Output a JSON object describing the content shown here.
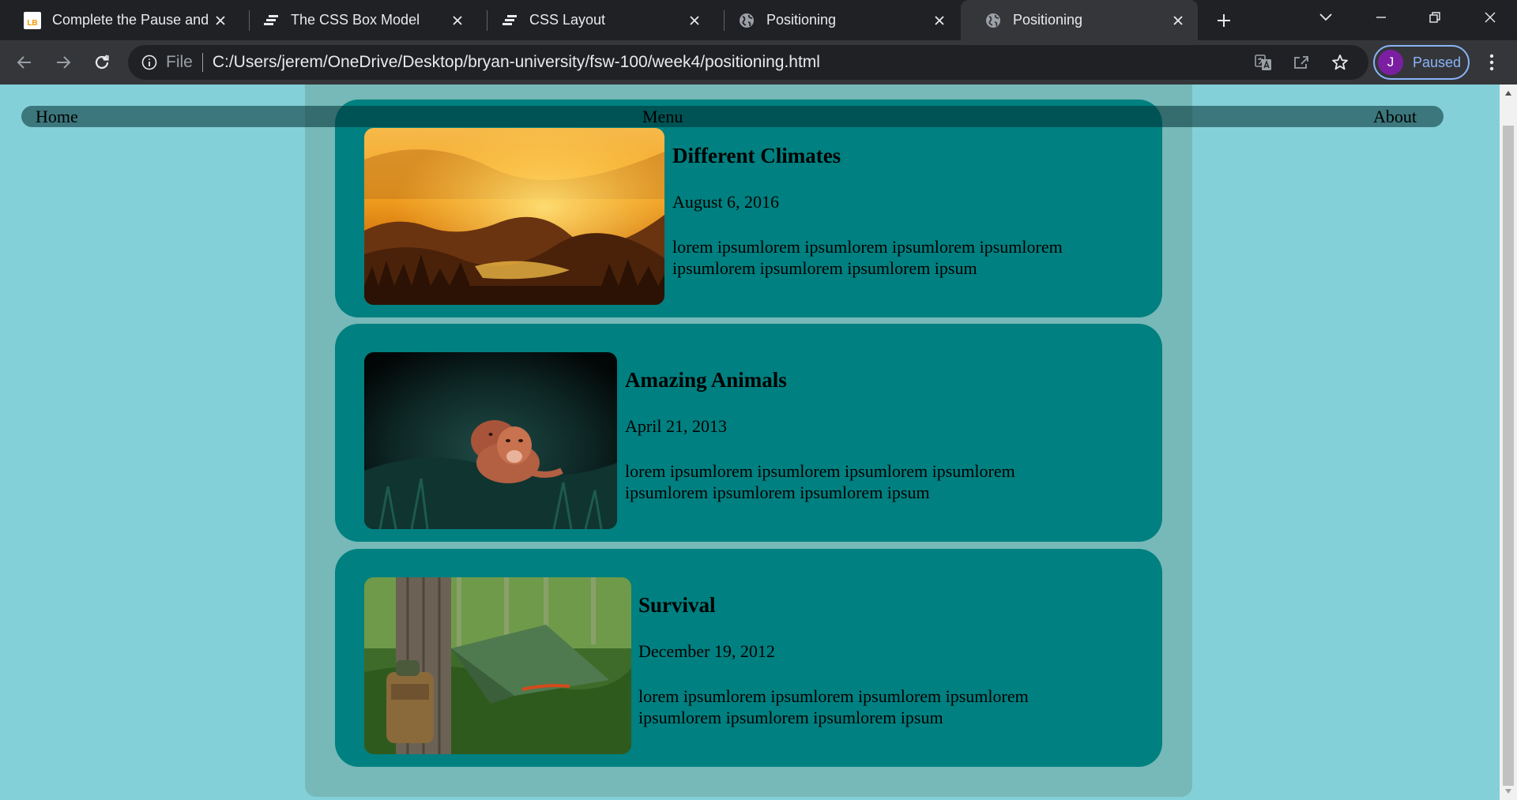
{
  "browser": {
    "tabs": [
      {
        "title": "Complete the Pause and F",
        "favicon": "lb-icon",
        "active": false
      },
      {
        "title": "The CSS Box Model",
        "favicon": "bars-icon",
        "active": false
      },
      {
        "title": "CSS Layout",
        "favicon": "bars-icon",
        "active": false
      },
      {
        "title": "Positioning",
        "favicon": "globe-icon",
        "active": false
      },
      {
        "title": "Positioning",
        "favicon": "globe-icon",
        "active": true
      }
    ],
    "favicon_text": "LB",
    "address": {
      "scheme_label": "File",
      "url": "C:/Users/jerem/OneDrive/Desktop/bryan-university/fsw-100/week4/positioning.html"
    },
    "profile": {
      "initial": "J",
      "label": "Paused",
      "accent": "#8ab4f8",
      "avatar_color": "#7b1fa2"
    }
  },
  "page": {
    "nav": {
      "home": "Home",
      "menu": "Menu",
      "about": "About"
    },
    "posts": [
      {
        "title": "Different Climates",
        "date": "August 6, 2016",
        "body": "lorem ipsumlorem ipsumlorem ipsumlorem ipsumlorem ipsumlorem ipsumlorem ipsumlorem ipsum",
        "image": "misty-forest-sunrise"
      },
      {
        "title": "Amazing Animals",
        "date": "April 21, 2013",
        "body": "lorem ipsumlorem ipsumlorem ipsumlorem ipsumlorem ipsumlorem ipsumlorem ipsumlorem ipsum",
        "image": "lionesses-in-grass"
      },
      {
        "title": "Survival",
        "date": "December 19, 2012",
        "body": "lorem ipsumlorem ipsumlorem ipsumlorem ipsumlorem ipsumlorem ipsumlorem ipsumlorem ipsum",
        "image": "tarp-shelter-camp"
      }
    ],
    "colors": {
      "background": "#84d0d8",
      "wrapper": "#76b9b8",
      "card": "#008080"
    }
  }
}
